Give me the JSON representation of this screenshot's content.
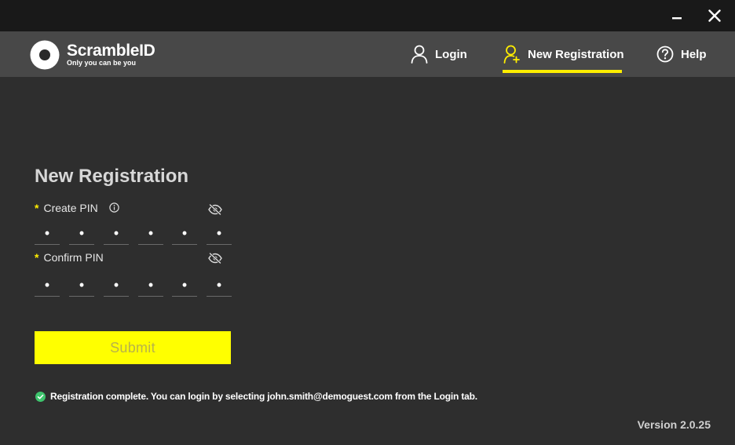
{
  "window": {
    "minimize_icon": "minimize-icon",
    "close_icon": "close-icon"
  },
  "header": {
    "brand_name": "ScrambleID",
    "brand_tagline": "Only you can be you",
    "nav": [
      {
        "label": "Login",
        "icon": "user-icon",
        "active": false
      },
      {
        "label": "New Registration",
        "icon": "user-add-icon",
        "active": true
      },
      {
        "label": "Help",
        "icon": "help-icon",
        "active": false
      }
    ],
    "active_color": "#ffee00"
  },
  "form": {
    "title": "New Registration",
    "required_marker": "*",
    "create_pin": {
      "label": "Create PIN",
      "digits": [
        "•",
        "•",
        "•",
        "•",
        "•",
        "•"
      ]
    },
    "confirm_pin": {
      "label": "Confirm PIN",
      "digits": [
        "•",
        "•",
        "•",
        "•",
        "•",
        "•"
      ]
    },
    "submit_label": "Submit"
  },
  "status": {
    "message": "Registration complete. You can login by selecting john.smith@demoguest.com from the Login tab.",
    "icon": "check-circle-icon",
    "color": "#3ec46d"
  },
  "footer": {
    "version": "Version 2.0.25"
  }
}
